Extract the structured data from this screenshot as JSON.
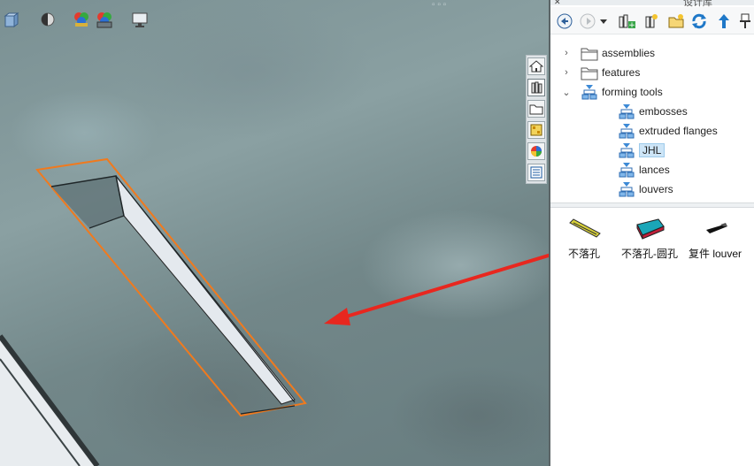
{
  "viewport": {
    "top_icons": [
      "cube-view-icon",
      "appearance-icon",
      "scene-icon",
      "render-icon",
      "display-icon"
    ],
    "accent_orange": "#f07a1e",
    "arrow_color": "#e8271f"
  },
  "panel": {
    "title": "设计库",
    "toolbar": [
      "back-icon",
      "forward-icon",
      "dropdown-icon",
      "add-to-library-icon",
      "add-file-location-icon",
      "create-folder-icon",
      "refresh-icon",
      "up-level-icon",
      "pin-icon"
    ],
    "tree": [
      {
        "label": "assemblies",
        "type": "folder",
        "expanded": false
      },
      {
        "label": "features",
        "type": "folder",
        "expanded": false
      },
      {
        "label": "forming tools",
        "type": "forming-folder",
        "expanded": true
      },
      {
        "label": "embosses",
        "type": "forming-folder"
      },
      {
        "label": "extruded flanges",
        "type": "forming-folder"
      },
      {
        "label": "JHL",
        "type": "forming-folder",
        "selected": true
      },
      {
        "label": "lances",
        "type": "forming-folder"
      },
      {
        "label": "louvers",
        "type": "forming-folder"
      }
    ],
    "items": [
      {
        "caption": "不落孔"
      },
      {
        "caption": "不落孔-圆孔"
      },
      {
        "caption": "复件 louver"
      }
    ]
  },
  "side_tabs": [
    "home-tab-icon",
    "design-library-tab-icon",
    "file-explorer-tab-icon",
    "view-palette-tab-icon",
    "appearances-tab-icon",
    "custom-properties-tab-icon"
  ]
}
